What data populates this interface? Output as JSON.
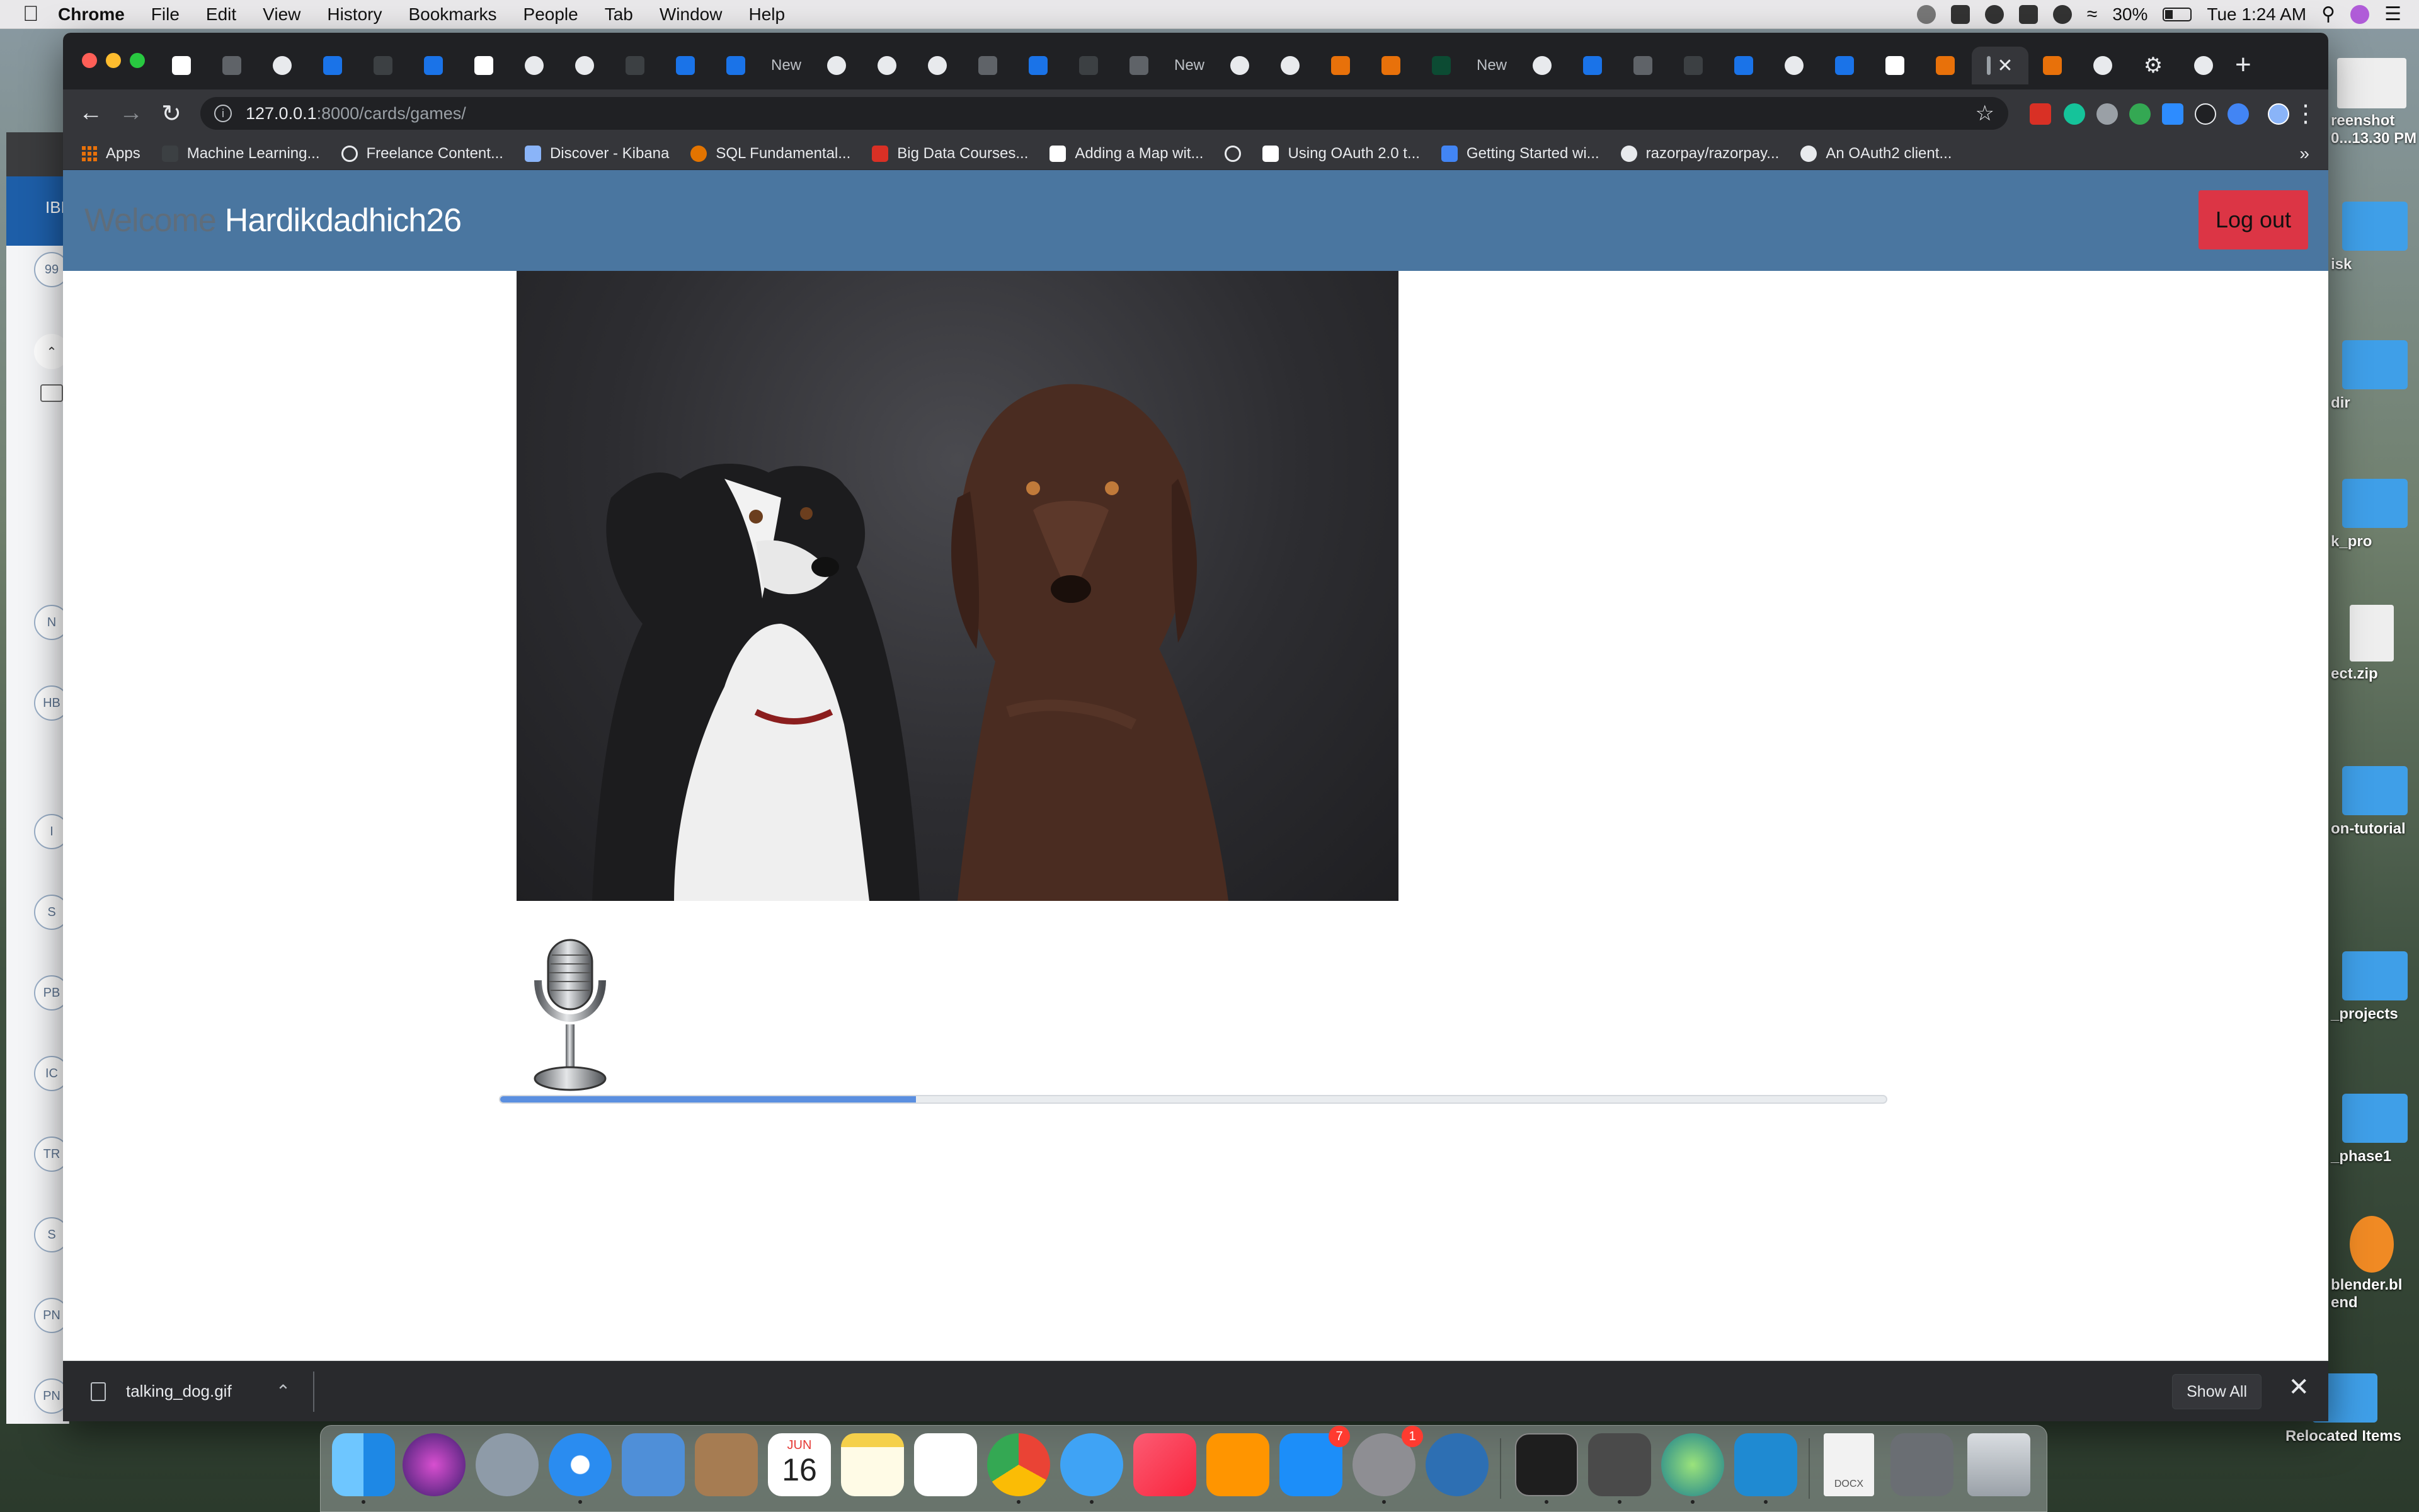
{
  "menubar": {
    "app_name": "Chrome",
    "items": [
      "File",
      "Edit",
      "View",
      "History",
      "Bookmarks",
      "People",
      "Tab",
      "Window",
      "Help"
    ],
    "battery": "30%",
    "clock": "Tue 1:24 AM"
  },
  "background_window": {
    "title_fragment": "IBM",
    "avatars": [
      "N",
      "HB",
      "I",
      "S",
      "PB",
      "IC",
      "TR",
      "S",
      "PN",
      "PN"
    ],
    "counter": "99"
  },
  "browser": {
    "tabs": [
      "New",
      "New",
      "New"
    ],
    "url_host": "127.0.0.1",
    "url_path": ":8000/cards/games/",
    "bookmarks": [
      "Apps",
      "Machine Learning...",
      "Freelance Content...",
      "Discover - Kibana",
      "SQL Fundamental...",
      "Big Data Courses...",
      "Adding a Map wit...",
      "Using OAuth 2.0 t...",
      "Getting Started wi...",
      "razorpay/razorpay...",
      "An OAuth2 client..."
    ]
  },
  "page": {
    "welcome_text": "Welcome",
    "username": "Hardikdadhich26",
    "logout_label": "Log out",
    "progress_fraction": 0.3
  },
  "downloads": {
    "file_name": "talking_dog.gif",
    "show_all": "Show All"
  },
  "desktop": {
    "items": [
      "reenshot",
      "0...13.30 PM",
      "isk",
      "dir",
      "k_pro",
      "ect.zip",
      "on-tutorial",
      "_projects",
      "_phase1",
      "blender.bl",
      "end",
      "Relocated Items"
    ]
  },
  "dock": {
    "calendar_month": "JUN",
    "calendar_day": "16",
    "appstore_badge": "7",
    "prefs_badge": "1",
    "doc_label": "DOCX"
  },
  "colors": {
    "navbar": "#4a76a0",
    "logout": "#dc3545",
    "progress": "#5b8fe0"
  }
}
